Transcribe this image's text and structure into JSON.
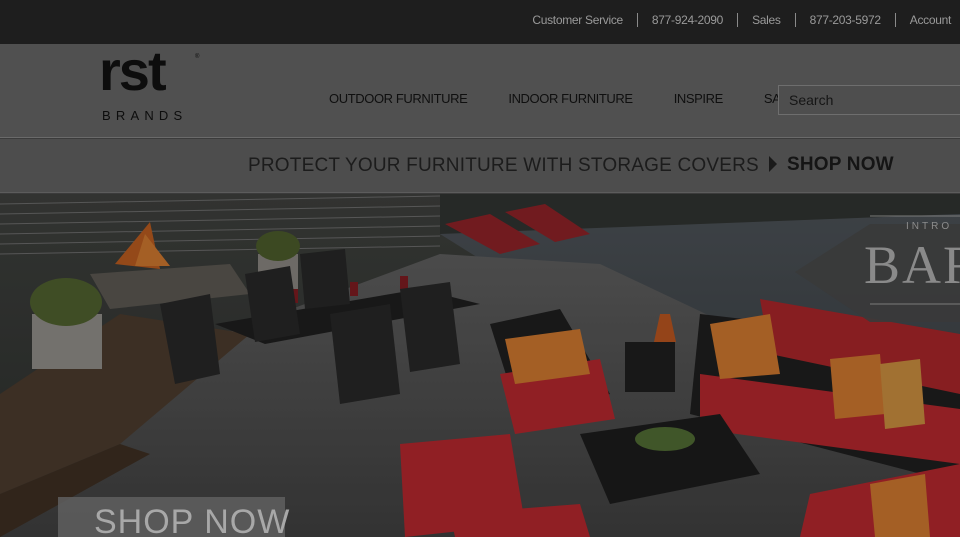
{
  "topbar": {
    "links": [
      "Customer Service",
      "877-924-2090",
      "Sales",
      "877-203-5972",
      "Account"
    ]
  },
  "header": {
    "logo_word": "rst",
    "logo_sub": "BRANDS",
    "logo_tm": "®",
    "nav": [
      "OUTDOOR FURNITURE",
      "INDOOR FURNITURE",
      "INSPIRE",
      "SALE"
    ],
    "search_placeholder": "Search"
  },
  "promo": {
    "message": "PROTECT YOUR FURNITURE WITH STORAGE COVERS",
    "cta": "SHOP NOW"
  },
  "hero": {
    "cta": "SHOP NOW",
    "badge_intro": "INTRO",
    "badge_word": "BAR"
  },
  "colors": {
    "overlay": "#000000",
    "accent_red": "#b0272c",
    "stripe_orange": "#c9742e"
  }
}
